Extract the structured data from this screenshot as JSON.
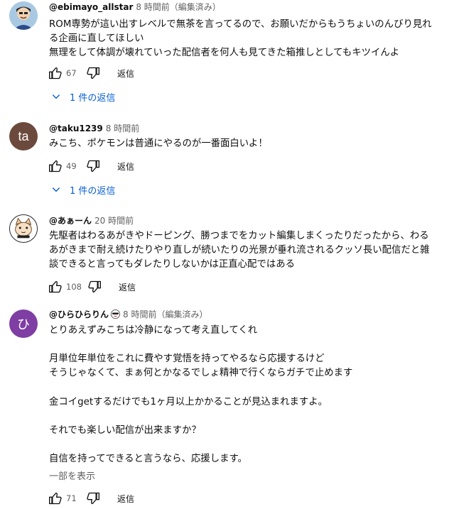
{
  "comments": [
    {
      "author": "@ebimayo_allstar",
      "meta": "8 時間前（編集済み）",
      "lines": [
        "ROM専勢が這い出すレベルで無茶を言ってるので、お願いだからもうちょいのんびり見れ",
        "る企画に直してほしい",
        "無理をして体調が壊れていった配信者を何人も見てきた箱推しとしてもキツイんよ"
      ],
      "likes": "67",
      "reply_label": "返信",
      "replies_label": "1 件の返信",
      "avatar_icon": "cartoon-person-icon"
    },
    {
      "author": "@taku1239",
      "meta": "8 時間前",
      "avatar_text": "ta",
      "avatar_color": "#6b4a3d",
      "lines": [
        "みこち、ポケモンは普通にやるのが一番面白いよ！"
      ],
      "likes": "49",
      "reply_label": "返信",
      "replies_label": "1 件の返信"
    },
    {
      "author": "@あぁーん",
      "meta": "20 時間前",
      "lines": [
        "先駆者はわるあがきやドーピング、勝つまでをカット編集しまくったりだったから、わる",
        "あがきまで耐え続けたりやり直しが続いたりの光景が垂れ流されるクッソ長い配信だと雑",
        "談できると言ってもダレたりしないかは正直心配ではある"
      ],
      "likes": "108",
      "reply_label": "返信",
      "avatar_icon": "cat-face-icon"
    },
    {
      "author": "@ひらひらりん",
      "meta": "8 時間前（編集済み）",
      "avatar_text": "ひ",
      "avatar_color": "#7e3ea3",
      "lines": [
        "とりあえずみこちは冷静になって考え直してくれ",
        "",
        "月単位年単位をこれに費やす覚悟を持ってやるなら応援するけど",
        "そうじゃなくて、まぁ何とかなるでしょ精神で行くならガチで止めます",
        "",
        "金コイgetするだけでも1ヶ月以上かかることが見込まれますよ。",
        "",
        "それでも楽しい配信が出来ますか？",
        "",
        "自信を持ってできると言うなら、応援します。"
      ],
      "show_more": "一部を表示",
      "likes": "71",
      "reply_label": "返信"
    }
  ]
}
